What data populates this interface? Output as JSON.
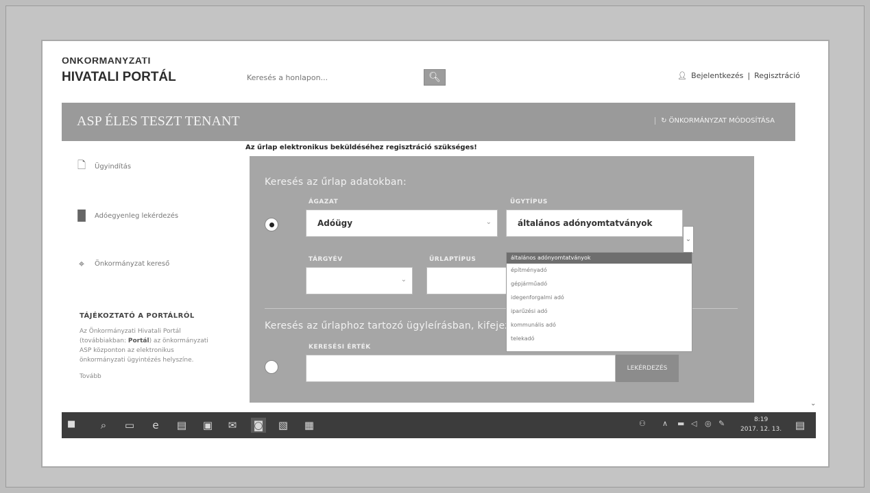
{
  "header": {
    "brand_line1": "ÖNKORMÁNYZATI",
    "brand_line2": "HIVATALI PORTÁL",
    "search_placeholder": "Keresés a honlapon...",
    "search_icon": "magnifier-icon",
    "login_label": "Bejelentkezés",
    "separator": "|",
    "register_label": "Regisztráció"
  },
  "tenant": {
    "title": "ASP ÉLES TESZT TENANT",
    "change_label": "ÖNKORMÁNYZAT MÓDOSÍTÁSA"
  },
  "notice": "Az űrlap elektronikus beküldéséhez regisztráció szükséges!",
  "sidebar": {
    "items": [
      {
        "label": "Ügyindítás",
        "icon": "document-search-icon"
      },
      {
        "label": "Adóegyenleg lekérdezés",
        "icon": "bar-chart-icon"
      },
      {
        "label": "Önkormányzat kereső",
        "icon": "map-pin-icon"
      }
    ],
    "info": {
      "heading": "TÁJÉKOZTATÓ A PORTÁLRÓL",
      "text_before": "Az Önkormányzati Hivatali Portál (továbbiakban: ",
      "text_bold": "Portál",
      "text_after": ") az önkormányzati ASP központon az elektronikus önkormányzati ügyintézés helyszíne.",
      "more": "Tovább"
    }
  },
  "search_panel": {
    "title": "Keresés az űrlap adatokban:",
    "agazat_label": "ÁGAZAT",
    "agazat_value": "Adóügy",
    "ugytipus_label": "ÜGYTÍPUS",
    "ugytipus_value": "általános adónyomtatványok",
    "targyev_label": "TÁRGYÉV",
    "urlaptipus_label": "ŰRLAPTÍPUS",
    "desc_title": "Keresés az űrlaphoz tartozó ügyleírásban, kifejezés alapján:",
    "keresesi_label": "KERESÉSI ÉRTÉK",
    "query_button": "LEKÉRDEZÉS"
  },
  "ugytipus_options": [
    "általános adónyomtatványok",
    "építményadó",
    "gépjárműadó",
    "idegenforgalmi adó",
    "iparűzési adó",
    "kommunális adó",
    "telekadó"
  ],
  "taskbar": {
    "time": "8:19",
    "date": "2017. 12. 13."
  }
}
